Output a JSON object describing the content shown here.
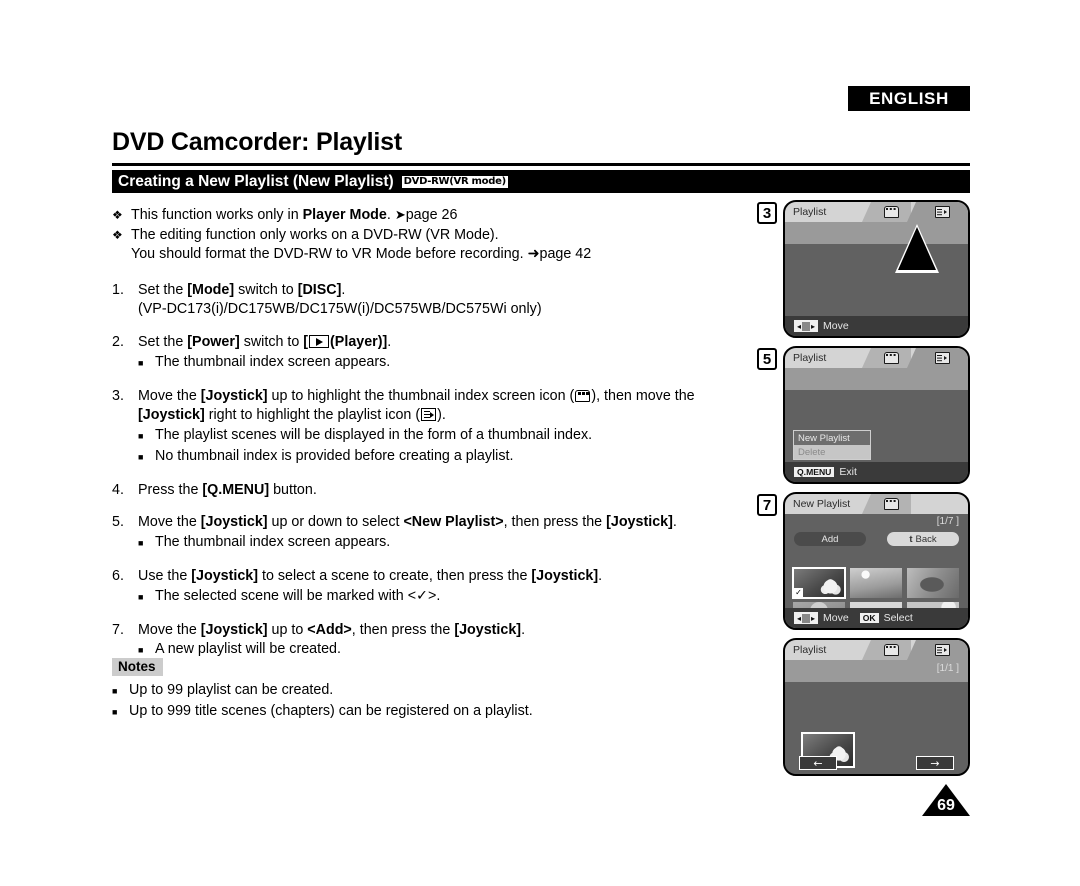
{
  "header": {
    "language_badge": "ENGLISH",
    "page_title": "DVD Camcorder: Playlist",
    "section_title": "Creating a New Playlist (New Playlist)",
    "disc_badge": "DVD-RW(VR mode)"
  },
  "intro_bullets": [
    {
      "marker": "❖",
      "text_before": "This function works only in ",
      "bold": "Player Mode",
      "text_after": ". ➜page 26"
    },
    {
      "marker": "❖",
      "text_before": "The editing function only works on a DVD-RW (VR Mode).",
      "bold": "",
      "text_after": ""
    }
  ],
  "intro_continued": "You should format the DVD-RW to VR Mode before recording. ➜page 42",
  "steps": [
    {
      "number": "1.",
      "line_parts": [
        "Set the ",
        "[Mode]",
        " switch to ",
        "[DISC]",
        "."
      ],
      "continued": "(VP-DC173(i)/DC175WB/DC175W(i)/DC575WB/DC575Wi only)",
      "subs": []
    },
    {
      "number": "2.",
      "line_parts": [
        "Set the ",
        "[Power]",
        " switch to ",
        "[",
        "(Player)]",
        "."
      ],
      "continued": "",
      "subs": [
        "The thumbnail index screen appears."
      ]
    },
    {
      "number": "3.",
      "line_parts": [
        "Move the ",
        "[Joystick]",
        " up to highlight the thumbnail index screen icon (",
        "), then move the ",
        "[Joystick]",
        " right to highlight the playlist icon (",
        ")."
      ],
      "continued": "",
      "subs": [
        "The playlist scenes will be displayed in the form of a thumbnail index.",
        "No thumbnail index is provided before creating a playlist."
      ]
    },
    {
      "number": "4.",
      "line_parts": [
        "Press the ",
        "[Q.MENU]",
        " button."
      ],
      "continued": "",
      "subs": []
    },
    {
      "number": "5.",
      "line_parts": [
        "Move the ",
        "[Joystick]",
        " up or down to select ",
        "<New Playlist>",
        ", then press the ",
        "[Joystick]",
        "."
      ],
      "continued": "",
      "subs": [
        "The thumbnail index screen appears."
      ]
    },
    {
      "number": "6.",
      "line_parts": [
        "Use the ",
        "[Joystick]",
        " to select a scene to create, then press the ",
        "[Joystick]",
        "."
      ],
      "continued": "",
      "subs": [
        "The selected scene will be marked with <✓>."
      ]
    },
    {
      "number": "7.",
      "line_parts": [
        "Move the ",
        "[Joystick]",
        " up to ",
        "<Add>",
        ", then press the ",
        "[Joystick]",
        "."
      ],
      "continued": "",
      "subs": [
        "A new playlist will be created."
      ]
    }
  ],
  "notes": {
    "label": "Notes",
    "items": [
      "Up to 99 playlist can be created.",
      "Up to 999 title scenes (chapters) can be registered on a playlist."
    ]
  },
  "panels": [
    {
      "step_number": "3",
      "title": "Playlist",
      "tabs": [
        "thumbnail-index-icon",
        "playlist-icon"
      ],
      "selected_tab": "playlist-icon",
      "bottom_hint_key": "",
      "bottom_hint_label": "Move",
      "pager": ""
    },
    {
      "step_number": "5",
      "title": "Playlist",
      "tabs": [
        "thumbnail-index-icon",
        "playlist-icon"
      ],
      "selected_tab": "playlist-icon",
      "menu": [
        {
          "label": "New Playlist",
          "state": "highlighted"
        },
        {
          "label": "Delete",
          "state": "disabled"
        }
      ],
      "bottom_hint_key": "Q.MENU",
      "bottom_hint_label": "Exit",
      "pager": ""
    },
    {
      "step_number": "7",
      "title": "New Playlist",
      "tabs": [
        "thumbnail-index-icon"
      ],
      "pager": "[1/7 ]",
      "add_button": "Add",
      "back_button": "Back",
      "back_prefix": "t",
      "thumbnail_count": 6,
      "selected_thumbnail_index": 1,
      "checkmark": "✓",
      "bottom_hint_move": "Move",
      "bottom_hint_ok_key": "OK",
      "bottom_hint_ok_label": "Select"
    },
    {
      "step_number": "",
      "title": "Playlist",
      "tabs": [
        "thumbnail-index-icon",
        "playlist-icon"
      ],
      "selected_tab": "playlist-icon",
      "pager": "[1/1 ]",
      "prev_button": "←",
      "next_button": "→",
      "thumbnail_count": 1
    }
  ],
  "footer": {
    "page_number": "69"
  },
  "colors": {
    "ink": "#000000",
    "paper": "#ffffff",
    "notes_bg": "#cccccc",
    "lcd_body": "#616161",
    "lcd_header": "#d4d4d4",
    "lcd_band": "#9a9a9a",
    "lcd_footer": "#3a3a3a"
  }
}
